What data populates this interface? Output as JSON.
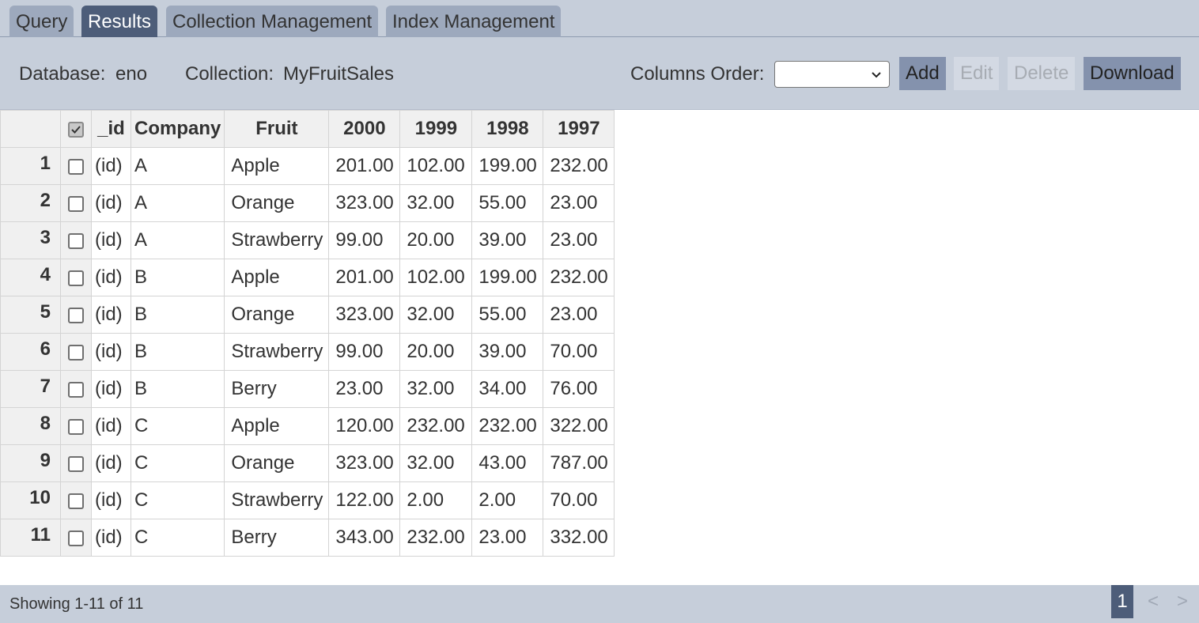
{
  "tabs": [
    {
      "label": "Query"
    },
    {
      "label": "Results"
    },
    {
      "label": "Collection Management"
    },
    {
      "label": "Index Management"
    }
  ],
  "toolbar": {
    "database_label": "Database:",
    "database_value": "eno",
    "collection_label": "Collection:",
    "collection_value": "MyFruitSales",
    "columns_order_label": "Columns Order:",
    "columns_order_value": "",
    "add_label": "Add",
    "edit_label": "Edit",
    "delete_label": "Delete",
    "download_label": "Download"
  },
  "table": {
    "headers": [
      "_id",
      "Company",
      "Fruit",
      "2000",
      "1999",
      "1998",
      "1997"
    ],
    "rows": [
      {
        "n": "1",
        "id": "(id)",
        "company": "A",
        "fruit": "Apple",
        "y2000": "201.00",
        "y1999": "102.00",
        "y1998": "199.00",
        "y1997": "232.00"
      },
      {
        "n": "2",
        "id": "(id)",
        "company": "A",
        "fruit": "Orange",
        "y2000": "323.00",
        "y1999": "32.00",
        "y1998": "55.00",
        "y1997": "23.00"
      },
      {
        "n": "3",
        "id": "(id)",
        "company": "A",
        "fruit": "Strawberry",
        "y2000": "99.00",
        "y1999": "20.00",
        "y1998": "39.00",
        "y1997": "23.00"
      },
      {
        "n": "4",
        "id": "(id)",
        "company": "B",
        "fruit": "Apple",
        "y2000": "201.00",
        "y1999": "102.00",
        "y1998": "199.00",
        "y1997": "232.00"
      },
      {
        "n": "5",
        "id": "(id)",
        "company": "B",
        "fruit": "Orange",
        "y2000": "323.00",
        "y1999": "32.00",
        "y1998": "55.00",
        "y1997": "23.00"
      },
      {
        "n": "6",
        "id": "(id)",
        "company": "B",
        "fruit": "Strawberry",
        "y2000": "99.00",
        "y1999": "20.00",
        "y1998": "39.00",
        "y1997": "70.00"
      },
      {
        "n": "7",
        "id": "(id)",
        "company": "B",
        "fruit": "Berry",
        "y2000": "23.00",
        "y1999": "32.00",
        "y1998": "34.00",
        "y1997": "76.00"
      },
      {
        "n": "8",
        "id": "(id)",
        "company": "C",
        "fruit": "Apple",
        "y2000": "120.00",
        "y1999": "232.00",
        "y1998": "232.00",
        "y1997": "322.00"
      },
      {
        "n": "9",
        "id": "(id)",
        "company": "C",
        "fruit": "Orange",
        "y2000": "323.00",
        "y1999": "32.00",
        "y1998": "43.00",
        "y1997": "787.00"
      },
      {
        "n": "10",
        "id": "(id)",
        "company": "C",
        "fruit": "Strawberry",
        "y2000": "122.00",
        "y1999": "2.00",
        "y1998": "2.00",
        "y1997": "70.00"
      },
      {
        "n": "11",
        "id": "(id)",
        "company": "C",
        "fruit": "Berry",
        "y2000": "343.00",
        "y1999": "232.00",
        "y1998": "23.00",
        "y1997": "332.00"
      }
    ]
  },
  "footer": {
    "status": "Showing 1-11 of 11",
    "current_page": "1",
    "prev_label": "<",
    "next_label": ">"
  }
}
